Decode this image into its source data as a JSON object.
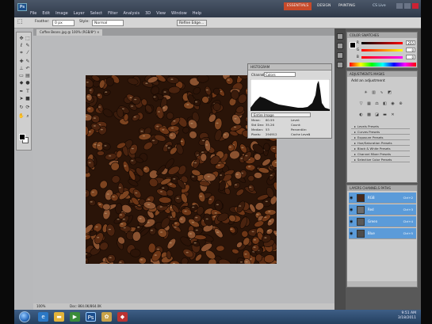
{
  "app": {
    "logo": "Ps",
    "workspaces": [
      "ESSENTIALS",
      "DESIGN",
      "PAINTING"
    ],
    "cs_live": "CS Live"
  },
  "menus": [
    "File",
    "Edit",
    "Image",
    "Layer",
    "Select",
    "Filter",
    "Analysis",
    "3D",
    "View",
    "Window",
    "Help"
  ],
  "options": {
    "feather_label": "Feather:",
    "feather_value": "0 px",
    "style_label": "Style:",
    "style_value": "Normal",
    "refine_label": "Refine Edge..."
  },
  "document_tab": "Coffee Beans.jpg @ 100% (RGB/8*) ×",
  "histogram": {
    "title": "HISTOGRAM",
    "channel_label": "Channel:",
    "channel_value": "Colors",
    "source": "Entire Image",
    "stats": [
      {
        "label": "Mean:",
        "value": "60.59"
      },
      {
        "label": "Std Dev:",
        "value": "35.26"
      },
      {
        "label": "Median:",
        "value": "53"
      },
      {
        "label": "Pixels:",
        "value": "294912"
      },
      {
        "label": "Level:",
        "value": ""
      },
      {
        "label": "Count:",
        "value": ""
      },
      {
        "label": "Percentile:",
        "value": ""
      },
      {
        "label": "Cache Level:",
        "value": "1"
      }
    ]
  },
  "color_panel": {
    "tabs": "COLOR  SWATCHES",
    "sliders": [
      {
        "label": "R",
        "value": "255"
      },
      {
        "label": "G",
        "value": "0"
      },
      {
        "label": "B",
        "value": "0"
      }
    ]
  },
  "adjustments": {
    "tabs": "ADJUSTMENTS  MASKS",
    "title": "Add an adjustment",
    "presets": [
      "Levels Presets",
      "Curves Presets",
      "Exposure Presets",
      "Hue/Saturation Presets",
      "Black & White Presets",
      "Channel Mixer Presets",
      "Selective Color Presets"
    ]
  },
  "layers": {
    "tabs": "LAYERS  CHANNELS  PATHS",
    "items": [
      {
        "name": "RGB",
        "key": "Ctrl+2",
        "thumb": "#4a2a1a"
      },
      {
        "name": "Red",
        "key": "Ctrl+3",
        "thumb": "#6c6c6c"
      },
      {
        "name": "Green",
        "key": "Ctrl+4",
        "thumb": "#5a5a5a"
      },
      {
        "name": "Blue",
        "key": "Ctrl+5",
        "thumb": "#4d4d4d"
      }
    ]
  },
  "status": {
    "zoom": "100%",
    "doc": "Doc: 864.0K/864.0K"
  },
  "taskbar": {
    "time": "9:51 AM",
    "date": "3/18/2011"
  },
  "colors": {
    "accent_workspace": "#c74a2a",
    "selection_blue": "#5b9bd9"
  }
}
